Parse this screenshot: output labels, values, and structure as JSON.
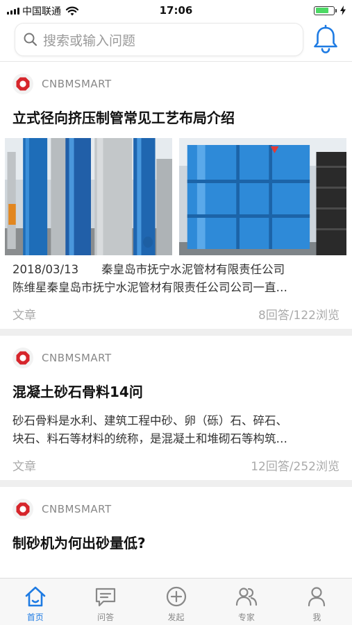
{
  "status_bar": {
    "carrier": "中国联通",
    "time": "17:06"
  },
  "search": {
    "placeholder": "搜索或输入问题"
  },
  "feed": [
    {
      "author": "CNBMSMART",
      "title": "立式径向挤压制管常见工艺布局介绍",
      "has_images": true,
      "summary_lines": [
        "2018/03/13　　秦皇岛市抚宁水泥管材有限责任公司",
        "陈维星秦皇岛市抚宁水泥管材有限责任公司公司一直…"
      ],
      "category": "文章",
      "stats": "8回答/122浏览"
    },
    {
      "author": "CNBMSMART",
      "title": "混凝土砂石骨料14问",
      "has_images": false,
      "summary_lines": [
        "砂石骨料是水利、建筑工程中砂、卵（砾）石、碎石、",
        "块石、料石等材料的统称，是混凝土和堆砌石等构筑…"
      ],
      "category": "文章",
      "stats": "12回答/252浏览"
    },
    {
      "author": "CNBMSMART",
      "title": "制砂机为何出砂量低?"
    }
  ],
  "tabbar": {
    "items": [
      {
        "label": "首页",
        "icon": "home-icon",
        "active": true
      },
      {
        "label": "问答",
        "icon": "chat-icon",
        "active": false
      },
      {
        "label": "发起",
        "icon": "add-circle-icon",
        "active": false
      },
      {
        "label": "专家",
        "icon": "experts-icon",
        "active": false
      },
      {
        "label": "我",
        "icon": "profile-icon",
        "active": false
      }
    ]
  },
  "colors": {
    "accent": "#1e7be3",
    "logo_red": "#d6252b",
    "inactive": "#888888"
  }
}
